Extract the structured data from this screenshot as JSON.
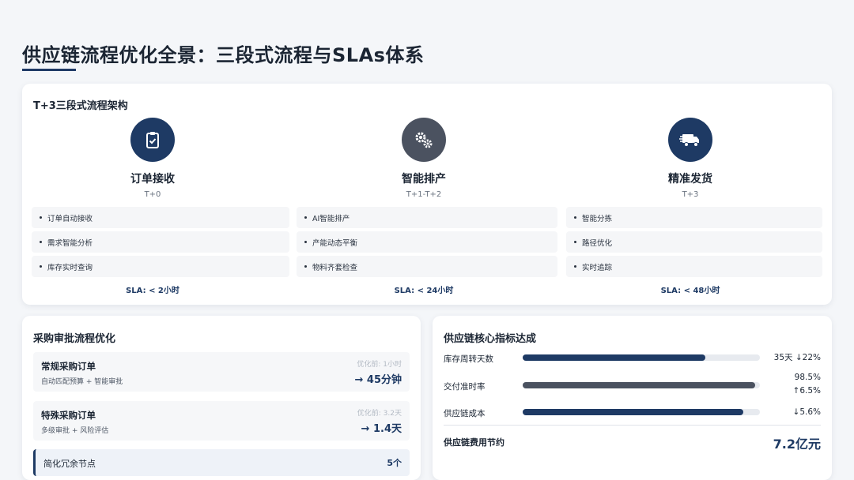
{
  "header": {
    "title": "供应链流程优化全景：三段式流程与SLAs体系"
  },
  "flow": {
    "title": "T+3三段式流程架构",
    "stages": [
      {
        "icon": "clipboard-check-icon",
        "name": "订单接收",
        "time": "T+0",
        "items": [
          "订单自动接收",
          "需求智能分析",
          "库存实时查询"
        ],
        "sla": "SLA: < 2小时"
      },
      {
        "icon": "gears-icon",
        "name": "智能排产",
        "time": "T+1-T+2",
        "items": [
          "AI智能排产",
          "产能动态平衡",
          "物料齐套检查"
        ],
        "sla": "SLA: < 24小时"
      },
      {
        "icon": "truck-icon",
        "name": "精准发货",
        "time": "T+3",
        "items": [
          "智能分拣",
          "路径优化",
          "实时追踪"
        ],
        "sla": "SLA: < 48小时"
      }
    ]
  },
  "procurement": {
    "title": "采购审批流程优化",
    "rows": [
      {
        "name": "常规采购订单",
        "desc": "自动匹配预算 + 智能审批",
        "before": "优化前: 1小时",
        "after": "→ 45分钟"
      },
      {
        "name": "特殊采购订单",
        "desc": "多级审批 + 风险评估",
        "before": "优化前: 3.2天",
        "after": "→ 1.4天"
      }
    ],
    "simplify": {
      "name": "简化冗余节点",
      "value": "5个"
    }
  },
  "kpi": {
    "title": "供应链核心指标达成",
    "metrics": [
      {
        "label": "库存周转天数",
        "value": "35天 ↓22%",
        "fill": 0.77,
        "color": "#1e3a64"
      },
      {
        "label": "交付准时率",
        "value": "98.5%",
        "value2": "↑6.5%",
        "fill": 0.98,
        "color": "#4b5260"
      },
      {
        "label": "供应链成本",
        "value": "↓5.6%",
        "fill": 0.93,
        "color": "#1e3a64"
      }
    ],
    "saving_label": "供应链费用节约",
    "saving_value": "7.2亿元"
  }
}
